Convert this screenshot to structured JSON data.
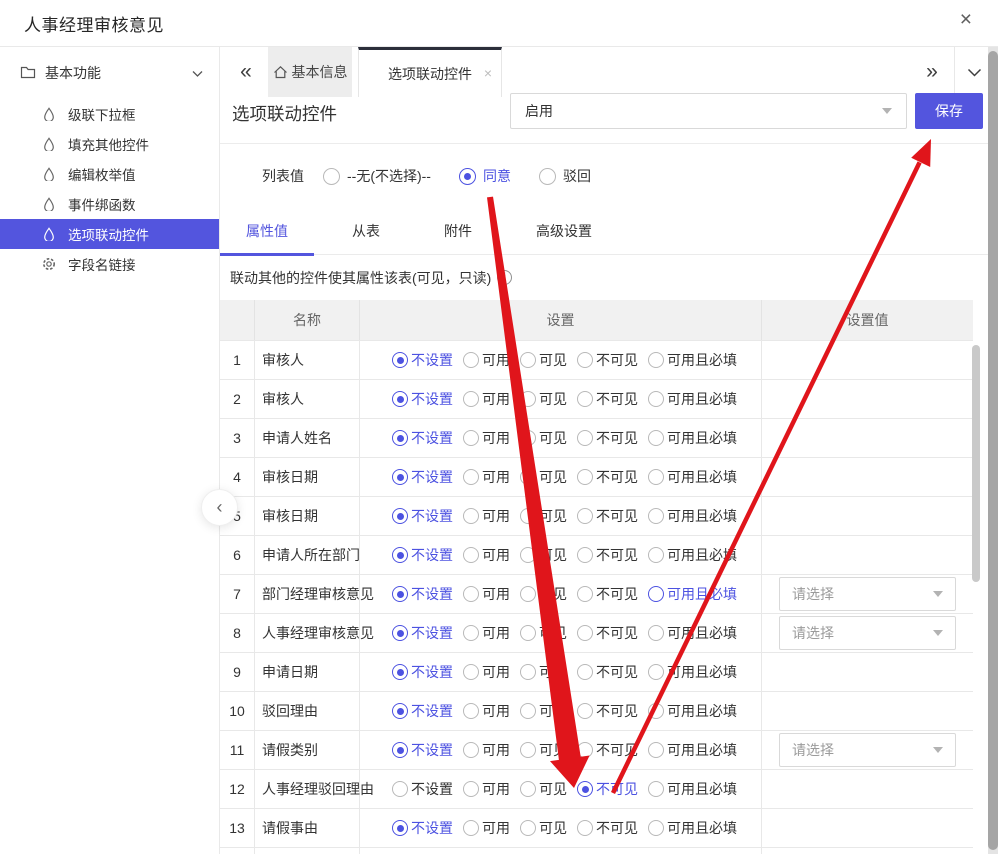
{
  "window": {
    "title": "人事经理审核意见"
  },
  "icons": {
    "close": "×",
    "tab_close": "×",
    "collapse_left": "«",
    "expand_right": "»",
    "back_chevron": "‹",
    "info": "i"
  },
  "sidebar": {
    "header": {
      "label": "基本功能",
      "icon": "folder",
      "chevron": "chevron-down"
    },
    "items": [
      {
        "label": "级联下拉框",
        "icon": "droplet",
        "selected": false
      },
      {
        "label": "填充其他控件",
        "icon": "droplet",
        "selected": false
      },
      {
        "label": "编辑枚举值",
        "icon": "droplet",
        "selected": false
      },
      {
        "label": "事件绑函数",
        "icon": "droplet",
        "selected": false
      },
      {
        "label": "选项联动控件",
        "icon": "droplet",
        "selected": true
      },
      {
        "label": "字段名链接",
        "icon": "gear",
        "selected": false
      }
    ]
  },
  "tabbar": {
    "tabs": [
      {
        "label": "基本信息",
        "icon": "home",
        "active": false
      },
      {
        "label": "选项联动控件",
        "active": true,
        "closable": true
      }
    ]
  },
  "panel": {
    "title": "选项联动控件",
    "status_select": {
      "value": "启用"
    },
    "save_button": "保存",
    "list_value": {
      "label": "列表值",
      "options": [
        {
          "label": "--无(不选择)--",
          "checked": false
        },
        {
          "label": "同意",
          "checked": true
        },
        {
          "label": "驳回",
          "checked": false
        }
      ]
    },
    "tabs": [
      {
        "label": "属性值",
        "active": true
      },
      {
        "label": "从表",
        "active": false
      },
      {
        "label": "附件",
        "active": false
      },
      {
        "label": "高级设置",
        "active": false
      }
    ],
    "hint": "联动其他的控件使其属性该表(可见，只读)"
  },
  "table": {
    "columns": [
      "",
      "名称",
      "设置",
      "设置值"
    ],
    "options": [
      "不设置",
      "可用",
      "可见",
      "不可见",
      "可用且必填"
    ],
    "select_placeholder": "请选择",
    "rows": [
      {
        "num": 1,
        "name": "审核人",
        "checked": "不设置"
      },
      {
        "num": 2,
        "name": "审核人",
        "checked": "不设置"
      },
      {
        "num": 3,
        "name": "申请人姓名",
        "checked": "不设置"
      },
      {
        "num": 4,
        "name": "审核日期",
        "checked": "不设置"
      },
      {
        "num": 5,
        "name": "审核日期",
        "checked": "不设置"
      },
      {
        "num": 6,
        "name": "申请人所在部门",
        "checked": "不设置"
      },
      {
        "num": 7,
        "name": "部门经理审核意见",
        "checked": "不设置",
        "highlight": "可用且必填",
        "has_select": true
      },
      {
        "num": 8,
        "name": "人事经理审核意见",
        "checked": "不设置",
        "has_select": true
      },
      {
        "num": 9,
        "name": "申请日期",
        "checked": "不设置"
      },
      {
        "num": 10,
        "name": "驳回理由",
        "checked": "不设置"
      },
      {
        "num": 11,
        "name": "请假类别",
        "checked": "不设置",
        "has_select": true
      },
      {
        "num": 12,
        "name": "人事经理驳回理由",
        "checked": "不可见"
      },
      {
        "num": 13,
        "name": "请假事由",
        "checked": "不设置"
      }
    ]
  },
  "colors": {
    "accent": "#5355de",
    "radio_accent": "#4c52e1",
    "active_tab_top": "#2b2e3a",
    "arrow_red": "#e0151b",
    "table_header_bg": "#f1f1f1",
    "row_border": "#e8e8e8"
  }
}
